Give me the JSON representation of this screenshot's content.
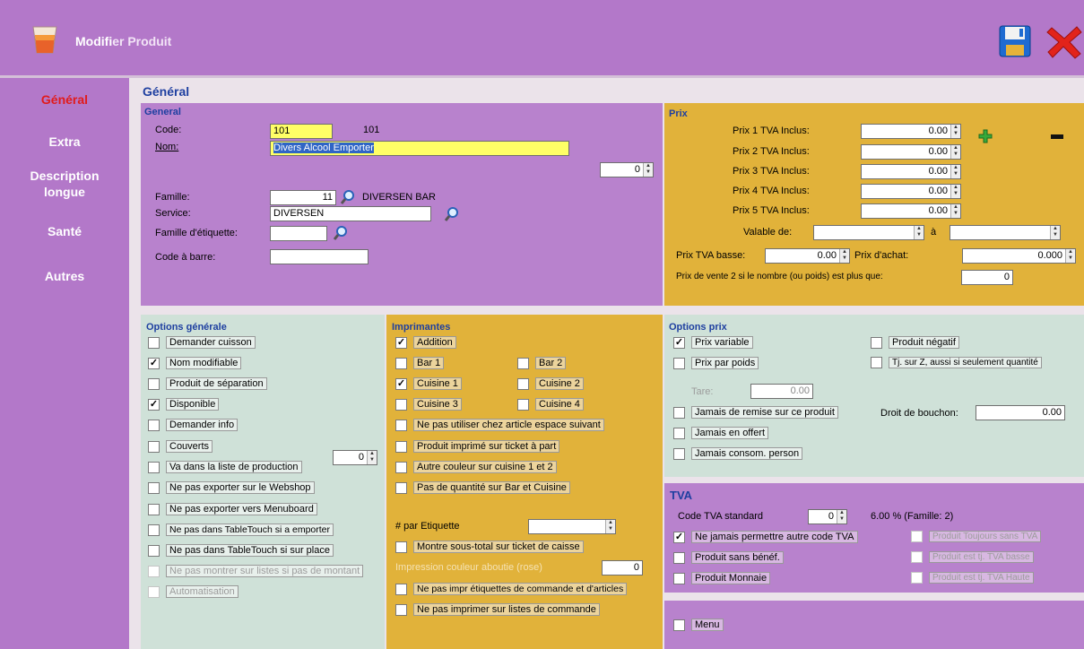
{
  "window": {
    "title_part1": "Modifi",
    "title_part2": "er Produit",
    "save_icon": "floppy-disk-icon",
    "close_icon": "red-x-icon"
  },
  "nav": {
    "items": [
      "Général",
      "Extra",
      "Description",
      "longue",
      "Santé",
      "Autres"
    ]
  },
  "content_title": "Général",
  "general": {
    "title": "General",
    "code_label": "Code:",
    "code_value": "101",
    "code_display": "101",
    "name_label": "Nom:",
    "name_value": "Divers Alcool Emporter",
    "order_value": "0",
    "family_label": "Famille:",
    "family_value": "11",
    "family_name": "DIVERSEN BAR",
    "service_label": "Service:",
    "service_value": "DIVERSEN",
    "label_family_label": "Famille d'étiquette:",
    "label_family_value": "",
    "barcode_label": "Code à barre:",
    "barcode_value": ""
  },
  "prix": {
    "title": "Prix",
    "prices": [
      {
        "label": "Prix 1 TVA Inclus:",
        "value": "0.00"
      },
      {
        "label": "Prix 2 TVA Inclus:",
        "value": "0.00"
      },
      {
        "label": "Prix 3 TVA Inclus:",
        "value": "0.00"
      },
      {
        "label": "Prix 4 TVA Inclus:",
        "value": "0.00"
      },
      {
        "label": "Prix 5 TVA Inclus:",
        "value": "0.00"
      }
    ],
    "valid_label": "Valable de:",
    "valid_to_label": "à",
    "low_vat_label": "Prix TVA basse:",
    "low_vat_value": "0.00",
    "purchase_label": "Prix d'achat:",
    "purchase_value": "0.000",
    "sale2_label": "Prix de vente 2 si le nombre (ou poids) est plus que:",
    "sale2_value": "0"
  },
  "options_generale": {
    "title": "Options générale",
    "items": [
      {
        "label": "Demander cuisson",
        "checked": false
      },
      {
        "label": "Nom modifiable",
        "checked": true
      },
      {
        "label": "Produit de séparation",
        "checked": false
      },
      {
        "label": "Disponible",
        "checked": true
      },
      {
        "label": "Demander info",
        "checked": false
      },
      {
        "label": "Couverts",
        "checked": false
      },
      {
        "label": "Va dans la liste de production",
        "checked": false
      },
      {
        "label": "Ne pas exporter sur le Webshop",
        "checked": false
      },
      {
        "label": "Ne pas exporter vers Menuboard",
        "checked": false
      },
      {
        "label": "Ne pas dans TableTouch si a emporter",
        "checked": false
      },
      {
        "label": "Ne pas dans TableTouch si sur place",
        "checked": false
      },
      {
        "label": "Ne pas montrer sur listes si pas de montant",
        "checked": false
      },
      {
        "label": "Automatisation",
        "checked": false
      }
    ],
    "couverts_value": "0"
  },
  "imprimantes": {
    "title": "Imprimantes",
    "addition": {
      "label": "Addition",
      "checked": true
    },
    "bar1": {
      "label": "Bar 1",
      "checked": false
    },
    "bar2": {
      "label": "Bar 2",
      "checked": false
    },
    "cuisine1": {
      "label": "Cuisine 1",
      "checked": true
    },
    "cuisine2": {
      "label": "Cuisine 2",
      "checked": false
    },
    "cuisine3": {
      "label": "Cuisine 3",
      "checked": false
    },
    "cuisine4": {
      "label": "Cuisine 4",
      "checked": false
    },
    "items": [
      {
        "label": "Ne pas utiliser chez article espace suivant",
        "checked": false
      },
      {
        "label": "Produit imprimé sur ticket à part",
        "checked": false
      },
      {
        "label": "Autre couleur sur cuisine 1 et 2",
        "checked": false
      },
      {
        "label": "Pas de quantité sur Bar et Cuisine",
        "checked": false
      }
    ],
    "per_label_label": "# par Etiquette",
    "subtotal": {
      "label": "Montre sous-total sur ticket de caisse",
      "checked": false
    },
    "print_color_label": "Impression couleur aboutie (rose)",
    "print_color_value": "0",
    "no_print_labels": {
      "label": "Ne pas impr étiquettes de commande et d'articles",
      "checked": false
    },
    "no_print_lists": {
      "label": "Ne pas imprimer sur listes de commande",
      "checked": false
    }
  },
  "options_prix": {
    "title": "Options prix",
    "prix_variable": {
      "label": "Prix variable",
      "checked": true
    },
    "produit_negatif": {
      "label": "Produit négatif",
      "checked": false
    },
    "prix_par_poids": {
      "label": "Prix par poids",
      "checked": false
    },
    "tj_sur_z": {
      "label": "Tj. sur Z, aussi si seulement quantité",
      "checked": false
    },
    "tare_label": "Tare:",
    "tare_value": "0.00",
    "jamais_remise": {
      "label": "Jamais de remise sur ce produit",
      "checked": false
    },
    "droit_label": "Droit de bouchon:",
    "droit_value": "0.00",
    "jamais_offert": {
      "label": "Jamais en offert",
      "checked": false
    },
    "jamais_consom": {
      "label": "Jamais consom. person",
      "checked": false
    }
  },
  "tva": {
    "title": "TVA",
    "code_label": "Code TVA standard",
    "code_value": "0",
    "rate_text": "6.00 % (Famille: 2)",
    "jamais_autre": {
      "label": "Ne jamais permettre autre code TVA",
      "checked": true
    },
    "toujours_sans": {
      "label": "Produit Toujours sans TVA",
      "checked": false
    },
    "sans_benef": {
      "label": "Produit sans bénéf.",
      "checked": false
    },
    "tva_basse": {
      "label": "Produit est tj. TVA basse",
      "checked": false
    },
    "monnaie": {
      "label": "Produit Monnaie",
      "checked": false
    },
    "tva_haute": {
      "label": "Produit est tj. TVA Haute",
      "checked": false
    }
  },
  "menu": {
    "label": "Menu",
    "checked": false
  }
}
